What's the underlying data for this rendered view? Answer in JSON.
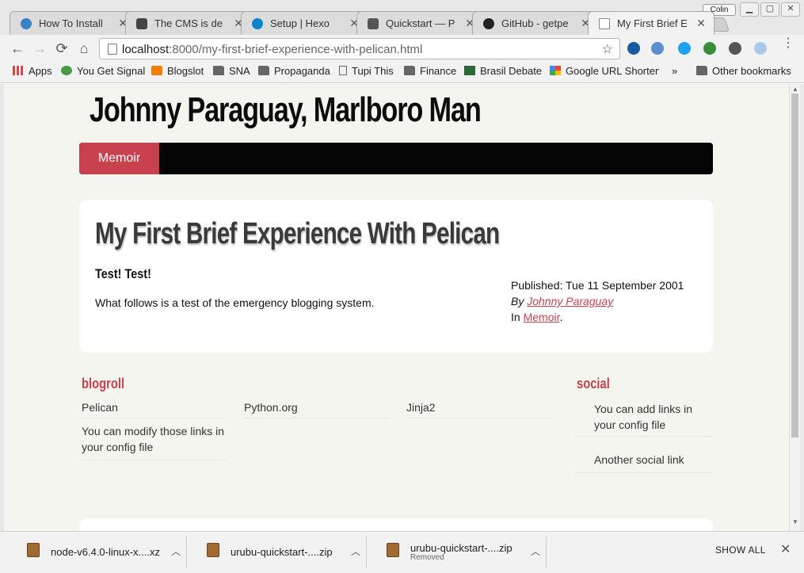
{
  "browser": {
    "tabs": [
      {
        "title": "How To Install",
        "favicon_color": "#3b82c4"
      },
      {
        "title": "The CMS is de",
        "favicon_color": "#444444"
      },
      {
        "title": "Setup | Hexo",
        "favicon_color": "#0e83cd"
      },
      {
        "title": "Quickstart — P",
        "favicon_color": "#555555"
      },
      {
        "title": "GitHub - getpe",
        "favicon_color": "#222222"
      },
      {
        "title": "My First Brief E",
        "favicon_color": "#888888"
      }
    ],
    "profile_name": "Colin",
    "url_host": "localhost",
    "url_rest": ":8000/my-first-brief-experience-with-pelican.html"
  },
  "bookmarks": [
    {
      "label": "Apps",
      "icon": "apps-grid-icon"
    },
    {
      "label": "You Get Signal",
      "icon": "globe-icon"
    },
    {
      "label": "Blogslot",
      "icon": "blogger-icon"
    },
    {
      "label": "SNA",
      "icon": "folder-icon"
    },
    {
      "label": "Propaganda",
      "icon": "folder-icon"
    },
    {
      "label": "Tupi This",
      "icon": "page-icon"
    },
    {
      "label": "Finance",
      "icon": "folder-icon"
    },
    {
      "label": "Brasil Debate",
      "icon": "brn-icon"
    },
    {
      "label": "Google URL Shortene",
      "icon": "google-icon"
    }
  ],
  "other_bookmarks": "Other bookmarks",
  "overflow": "»",
  "site": {
    "title": "Johnny Paraguay, Marlboro Man",
    "nav_active": "Memoir",
    "accent": "#c7424e"
  },
  "article": {
    "title": "My First Brief Experience With Pelican",
    "subtitle": "Test! Test!",
    "body": "What follows is a test of the emergency blogging system.",
    "published": "Published: Tue 11 September 2001",
    "by_prefix": "By",
    "author": "Johnny Paraguay",
    "in_prefix": "In",
    "category": "Memoir",
    "period": "."
  },
  "blogroll": {
    "heading": "blogroll",
    "links": [
      "Pelican",
      "Python.org",
      "Jinja2",
      "You can modify those links in your config file"
    ]
  },
  "social": {
    "heading": "social",
    "links": [
      "You can add links in your config file",
      "Another social link"
    ]
  },
  "downloads": {
    "items": [
      {
        "name": "node-v6.4.0-linux-x....xz",
        "status": ""
      },
      {
        "name": "urubu-quickstart-....zip",
        "status": ""
      },
      {
        "name": "urubu-quickstart-....zip",
        "status": "Removed"
      }
    ],
    "show_all": "SHOW ALL"
  }
}
